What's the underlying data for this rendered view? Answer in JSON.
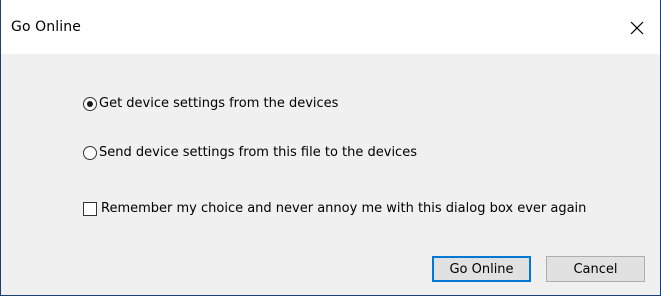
{
  "window": {
    "title": "Go Online",
    "close_glyph": "close-icon"
  },
  "options": {
    "get_settings_label": "Get device settings from the devices",
    "get_settings_selected": true,
    "send_settings_label": "Send device settings from this file to the devices",
    "send_settings_selected": false,
    "remember_label": "Remember my choice and never annoy me with this dialog box ever again",
    "remember_checked": false
  },
  "buttons": {
    "go_online_label": "Go Online",
    "cancel_label": "Cancel"
  },
  "colors": {
    "border": "#1c3f7a",
    "dialog_bg": "#f0f0f0",
    "default_button_border": "#0078d7"
  }
}
